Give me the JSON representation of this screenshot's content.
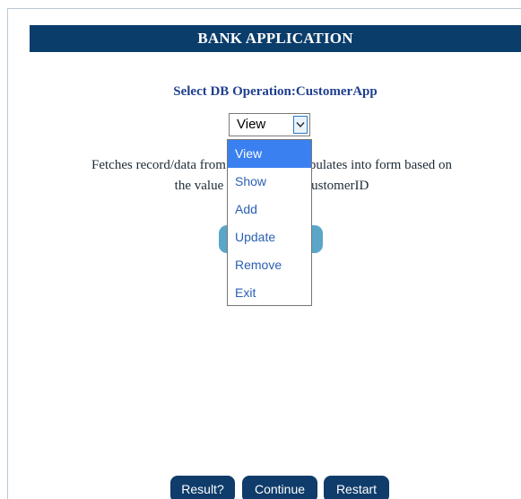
{
  "header": {
    "title": "BANK APPLICATION"
  },
  "operation": {
    "title": "Select DB Operation:CustomerApp",
    "select": {
      "value": "View",
      "options": [
        "View",
        "Show",
        "Add",
        "Update",
        "Remove",
        "Exit"
      ],
      "highlighted": "View"
    },
    "description": {
      "line1_left": "Fetches record/data from da",
      "line1_right": "populates into form based on",
      "line2_left": "the value of k",
      "line2_right": ":CustomerID"
    }
  },
  "footer": {
    "result_label": "Result?",
    "continue_label": "Continue",
    "restart_label": "Restart"
  },
  "colors": {
    "header_bg": "#0b3d6b",
    "title_text": "#1f3f8f",
    "dropdown_highlight": "#3a80f0",
    "footer_button_bg": "#0f3c6a",
    "go_button_bg": "#5aa6c9"
  }
}
